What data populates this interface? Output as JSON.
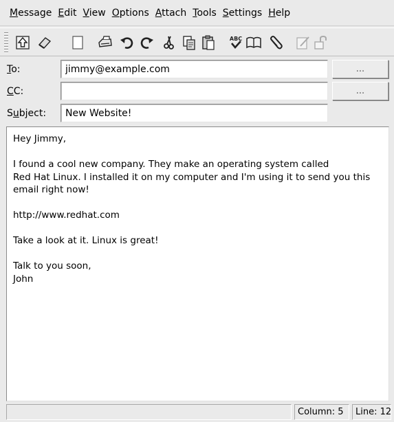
{
  "menubar": {
    "items": [
      {
        "pre": "",
        "u": "M",
        "post": "essage"
      },
      {
        "pre": "",
        "u": "E",
        "post": "dit"
      },
      {
        "pre": "",
        "u": "V",
        "post": "iew"
      },
      {
        "pre": "",
        "u": "O",
        "post": "ptions"
      },
      {
        "pre": "",
        "u": "A",
        "post": "ttach"
      },
      {
        "pre": "",
        "u": "T",
        "post": "ools"
      },
      {
        "pre": "",
        "u": "S",
        "post": "ettings"
      },
      {
        "pre": "",
        "u": "H",
        "post": "elp"
      }
    ]
  },
  "toolbar": {
    "buttons": [
      "send-icon",
      "erase-icon",
      "new-document-icon",
      "print-icon",
      "undo-icon",
      "redo-icon",
      "cut-icon",
      "copy-icon",
      "paste-icon",
      "spellcheck-icon",
      "address-book-icon",
      "attach-icon",
      "sign-icon",
      "encrypt-icon"
    ],
    "spellcheck_text": "ABC"
  },
  "fields": {
    "to": {
      "label_u": "T",
      "label_rest": "o:",
      "value": "jimmy@example.com",
      "button": "..."
    },
    "cc": {
      "label_u": "C",
      "label_rest": "C:",
      "value": "",
      "button": "..."
    },
    "subject": {
      "label_pre": "S",
      "label_u": "u",
      "label_rest": "bject:",
      "value": "New Website!"
    }
  },
  "body": {
    "lines": [
      "Hey Jimmy,",
      "",
      "I found a cool new company. They make an operating system called",
      "Red Hat Linux. I installed it on my computer and I'm using it to send you this",
      "email right now!",
      "",
      "http://www.redhat.com",
      "",
      "Take a look at it. Linux is great!",
      "",
      "Talk to you soon,",
      "John"
    ]
  },
  "status": {
    "column": "Column: 5",
    "line": "Line: 12"
  }
}
